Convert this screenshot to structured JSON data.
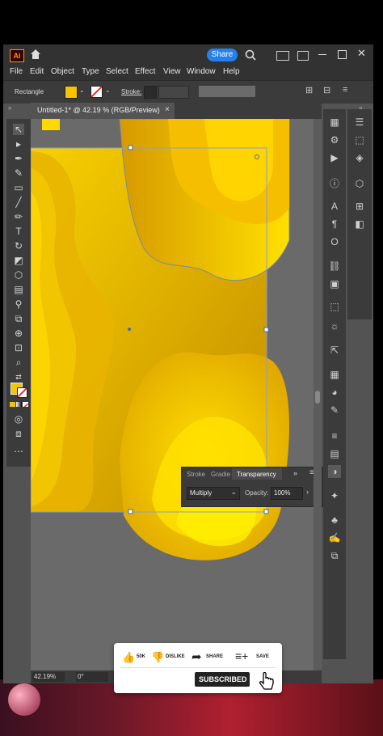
{
  "app": {
    "logo": "Ai",
    "share_label": "Share",
    "menu": [
      "File",
      "Edit",
      "Object",
      "Type",
      "Select",
      "Effect",
      "View",
      "Window",
      "Help"
    ]
  },
  "control": {
    "object_type": "Rectangle",
    "stroke_label": "Stroke:"
  },
  "document": {
    "tab_title": "Untitled-1* @ 42.19 % (RGB/Preview)",
    "close_glyph": "×"
  },
  "transparency_panel": {
    "tabs": [
      "Stroke",
      "Gradie",
      "Transparency"
    ],
    "blend_mode": "Multiply",
    "opacity_label": "Opacity:",
    "opacity_value": "100%"
  },
  "status": {
    "zoom": "42.19%",
    "rotation": "0°"
  },
  "youtube": {
    "likes": "50K",
    "dislike": "DISLIKE",
    "share": "SHARE",
    "save": "SAVE",
    "subscribed": "SUBSCRIBED"
  },
  "colors": {
    "accent_blue": "#2680eb",
    "fill_yellow": "#f5c400",
    "stroke_red": "#e03030",
    "artwork_light": "#ffd800",
    "artwork_dark": "#c08a00"
  }
}
